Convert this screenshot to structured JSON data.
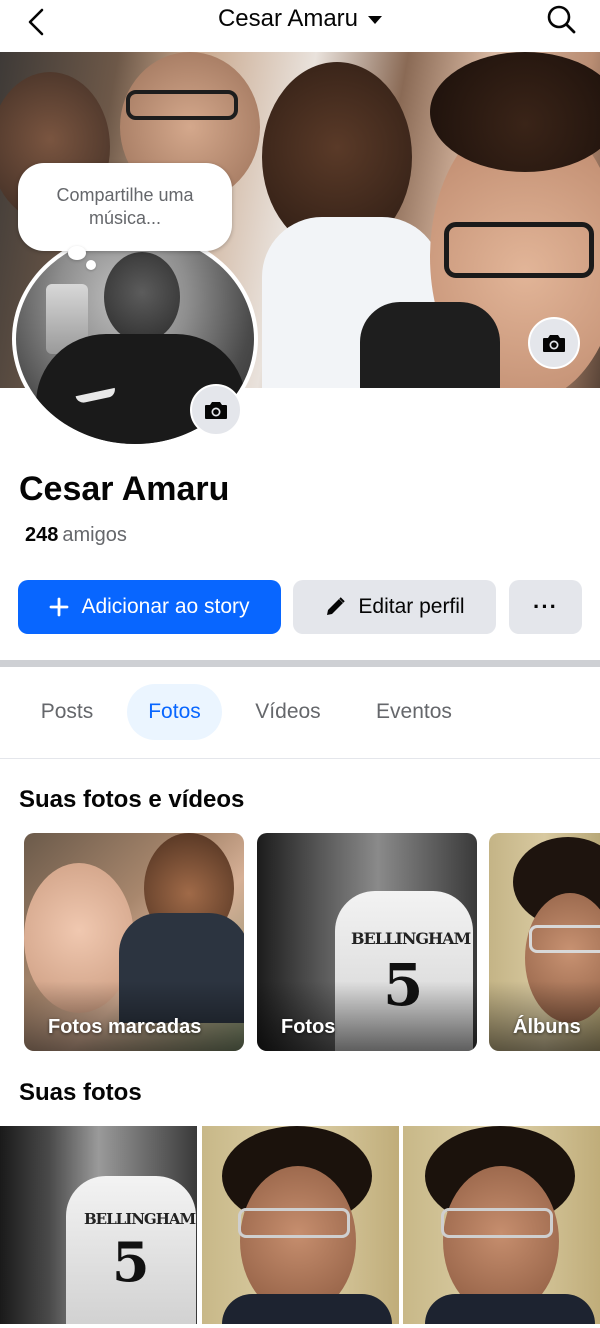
{
  "header": {
    "title": "Cesar Amaru"
  },
  "cover": {
    "status_bubble": "Compartilhe uma música..."
  },
  "profile": {
    "name": "Cesar Amaru",
    "friends_count": "248",
    "friends_label": "amigos"
  },
  "actions": {
    "add_story": "Adicionar ao story",
    "edit_profile": "Editar perfil",
    "more": "···"
  },
  "tabs": [
    {
      "label": "Posts",
      "active": false
    },
    {
      "label": "Fotos",
      "active": true
    },
    {
      "label": "Vídeos",
      "active": false
    },
    {
      "label": "Eventos",
      "active": false
    }
  ],
  "sections": {
    "photos_videos_title": "Suas fotos e vídeos",
    "your_photos_title": "Suas fotos"
  },
  "albums": [
    {
      "label": "Fotos marcadas"
    },
    {
      "label": "Fotos"
    },
    {
      "label": "Álbuns"
    }
  ],
  "jersey": {
    "name": "BELLINGHAM",
    "number": "5"
  },
  "colors": {
    "accent": "#0866ff",
    "accent_bg": "#ebf5ff",
    "button_grey": "#e4e6eb",
    "muted_text": "#65676b"
  }
}
